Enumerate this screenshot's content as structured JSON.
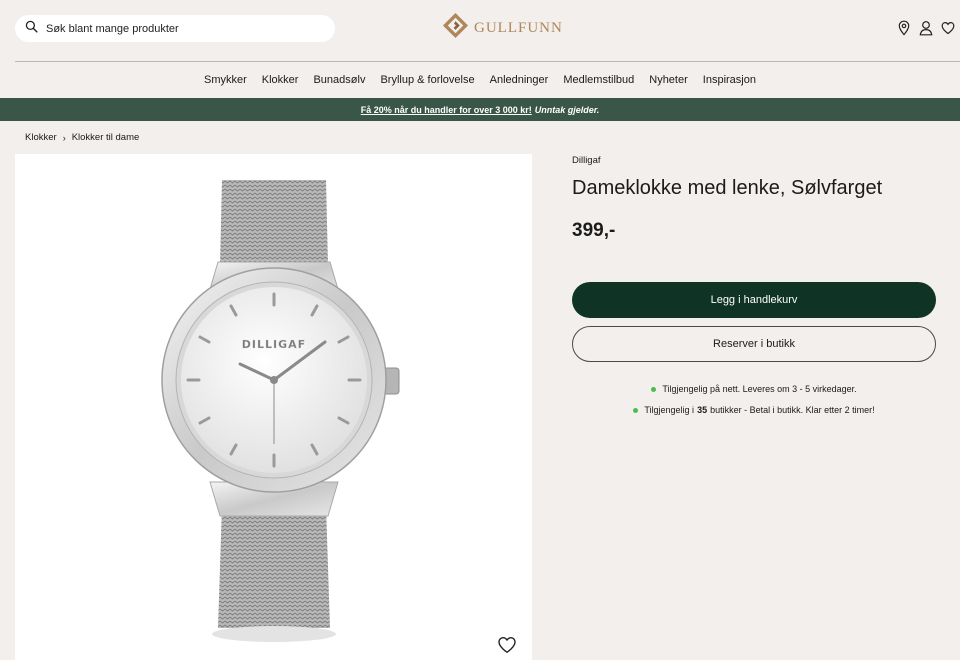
{
  "header": {
    "search_placeholder": "Søk blant mange produkter",
    "logo_text": "GULLFUNN",
    "icons": [
      "location-icon",
      "user-icon",
      "heart-icon"
    ]
  },
  "nav": {
    "items": [
      "Smykker",
      "Klokker",
      "Bunadsølv",
      "Bryllup & forlovelse",
      "Anledninger",
      "Medlemstilbud",
      "Nyheter",
      "Inspirasjon"
    ]
  },
  "promo": {
    "link_text": "Få 20% når du handler for over 3 000 kr!",
    "note": "Unntak gjelder."
  },
  "breadcrumb": {
    "items": [
      "Klokker",
      "Klokker til dame"
    ]
  },
  "product": {
    "brand": "Dilligaf",
    "title": "Dameklokke med lenke, Sølvfarget",
    "price": "399,-",
    "watch_dial_text": "DILLIGAF",
    "add_to_cart": "Legg i handlekurv",
    "reserve": "Reserver i butikk",
    "availability_online": "Tilgjengelig på nett. Leveres om 3 - 5 virkedager.",
    "availability_store_prefix": "Tilgjengelig i",
    "availability_store_count": "35",
    "availability_store_suffix": "butikker - Betal i butikk. Klar etter 2 timer!"
  },
  "colors": {
    "background": "#f2efec",
    "promo_bar": "#3a5649",
    "primary_button": "#0f3426",
    "logo_gold": "#b0875a",
    "stock_green": "#4bbd4b"
  }
}
